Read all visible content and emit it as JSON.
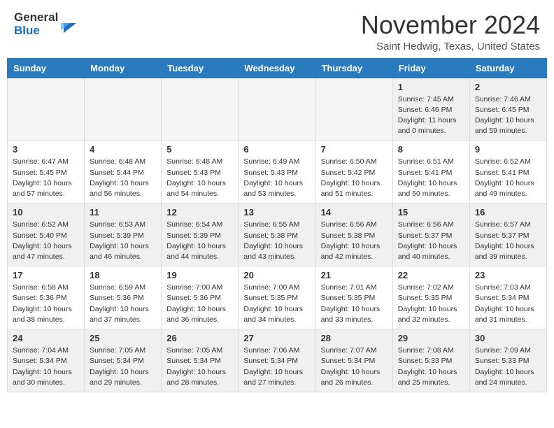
{
  "header": {
    "logo_general": "General",
    "logo_blue": "Blue",
    "month_title": "November 2024",
    "location": "Saint Hedwig, Texas, United States"
  },
  "days_of_week": [
    "Sunday",
    "Monday",
    "Tuesday",
    "Wednesday",
    "Thursday",
    "Friday",
    "Saturday"
  ],
  "weeks": [
    [
      {
        "day": "",
        "empty": true
      },
      {
        "day": "",
        "empty": true
      },
      {
        "day": "",
        "empty": true
      },
      {
        "day": "",
        "empty": true
      },
      {
        "day": "",
        "empty": true
      },
      {
        "day": "1",
        "sunrise": "Sunrise: 7:45 AM",
        "sunset": "Sunset: 6:46 PM",
        "daylight": "Daylight: 11 hours and 0 minutes."
      },
      {
        "day": "2",
        "sunrise": "Sunrise: 7:46 AM",
        "sunset": "Sunset: 6:45 PM",
        "daylight": "Daylight: 10 hours and 59 minutes."
      }
    ],
    [
      {
        "day": "3",
        "sunrise": "Sunrise: 6:47 AM",
        "sunset": "Sunset: 5:45 PM",
        "daylight": "Daylight: 10 hours and 57 minutes."
      },
      {
        "day": "4",
        "sunrise": "Sunrise: 6:48 AM",
        "sunset": "Sunset: 5:44 PM",
        "daylight": "Daylight: 10 hours and 56 minutes."
      },
      {
        "day": "5",
        "sunrise": "Sunrise: 6:48 AM",
        "sunset": "Sunset: 5:43 PM",
        "daylight": "Daylight: 10 hours and 54 minutes."
      },
      {
        "day": "6",
        "sunrise": "Sunrise: 6:49 AM",
        "sunset": "Sunset: 5:43 PM",
        "daylight": "Daylight: 10 hours and 53 minutes."
      },
      {
        "day": "7",
        "sunrise": "Sunrise: 6:50 AM",
        "sunset": "Sunset: 5:42 PM",
        "daylight": "Daylight: 10 hours and 51 minutes."
      },
      {
        "day": "8",
        "sunrise": "Sunrise: 6:51 AM",
        "sunset": "Sunset: 5:41 PM",
        "daylight": "Daylight: 10 hours and 50 minutes."
      },
      {
        "day": "9",
        "sunrise": "Sunrise: 6:52 AM",
        "sunset": "Sunset: 5:41 PM",
        "daylight": "Daylight: 10 hours and 49 minutes."
      }
    ],
    [
      {
        "day": "10",
        "sunrise": "Sunrise: 6:52 AM",
        "sunset": "Sunset: 5:40 PM",
        "daylight": "Daylight: 10 hours and 47 minutes."
      },
      {
        "day": "11",
        "sunrise": "Sunrise: 6:53 AM",
        "sunset": "Sunset: 5:39 PM",
        "daylight": "Daylight: 10 hours and 46 minutes."
      },
      {
        "day": "12",
        "sunrise": "Sunrise: 6:54 AM",
        "sunset": "Sunset: 5:39 PM",
        "daylight": "Daylight: 10 hours and 44 minutes."
      },
      {
        "day": "13",
        "sunrise": "Sunrise: 6:55 AM",
        "sunset": "Sunset: 5:38 PM",
        "daylight": "Daylight: 10 hours and 43 minutes."
      },
      {
        "day": "14",
        "sunrise": "Sunrise: 6:56 AM",
        "sunset": "Sunset: 5:38 PM",
        "daylight": "Daylight: 10 hours and 42 minutes."
      },
      {
        "day": "15",
        "sunrise": "Sunrise: 6:56 AM",
        "sunset": "Sunset: 5:37 PM",
        "daylight": "Daylight: 10 hours and 40 minutes."
      },
      {
        "day": "16",
        "sunrise": "Sunrise: 6:57 AM",
        "sunset": "Sunset: 5:37 PM",
        "daylight": "Daylight: 10 hours and 39 minutes."
      }
    ],
    [
      {
        "day": "17",
        "sunrise": "Sunrise: 6:58 AM",
        "sunset": "Sunset: 5:36 PM",
        "daylight": "Daylight: 10 hours and 38 minutes."
      },
      {
        "day": "18",
        "sunrise": "Sunrise: 6:59 AM",
        "sunset": "Sunset: 5:36 PM",
        "daylight": "Daylight: 10 hours and 37 minutes."
      },
      {
        "day": "19",
        "sunrise": "Sunrise: 7:00 AM",
        "sunset": "Sunset: 5:36 PM",
        "daylight": "Daylight: 10 hours and 36 minutes."
      },
      {
        "day": "20",
        "sunrise": "Sunrise: 7:00 AM",
        "sunset": "Sunset: 5:35 PM",
        "daylight": "Daylight: 10 hours and 34 minutes."
      },
      {
        "day": "21",
        "sunrise": "Sunrise: 7:01 AM",
        "sunset": "Sunset: 5:35 PM",
        "daylight": "Daylight: 10 hours and 33 minutes."
      },
      {
        "day": "22",
        "sunrise": "Sunrise: 7:02 AM",
        "sunset": "Sunset: 5:35 PM",
        "daylight": "Daylight: 10 hours and 32 minutes."
      },
      {
        "day": "23",
        "sunrise": "Sunrise: 7:03 AM",
        "sunset": "Sunset: 5:34 PM",
        "daylight": "Daylight: 10 hours and 31 minutes."
      }
    ],
    [
      {
        "day": "24",
        "sunrise": "Sunrise: 7:04 AM",
        "sunset": "Sunset: 5:34 PM",
        "daylight": "Daylight: 10 hours and 30 minutes."
      },
      {
        "day": "25",
        "sunrise": "Sunrise: 7:05 AM",
        "sunset": "Sunset: 5:34 PM",
        "daylight": "Daylight: 10 hours and 29 minutes."
      },
      {
        "day": "26",
        "sunrise": "Sunrise: 7:05 AM",
        "sunset": "Sunset: 5:34 PM",
        "daylight": "Daylight: 10 hours and 28 minutes."
      },
      {
        "day": "27",
        "sunrise": "Sunrise: 7:06 AM",
        "sunset": "Sunset: 5:34 PM",
        "daylight": "Daylight: 10 hours and 27 minutes."
      },
      {
        "day": "28",
        "sunrise": "Sunrise: 7:07 AM",
        "sunset": "Sunset: 5:34 PM",
        "daylight": "Daylight: 10 hours and 26 minutes."
      },
      {
        "day": "29",
        "sunrise": "Sunrise: 7:08 AM",
        "sunset": "Sunset: 5:33 PM",
        "daylight": "Daylight: 10 hours and 25 minutes."
      },
      {
        "day": "30",
        "sunrise": "Sunrise: 7:09 AM",
        "sunset": "Sunset: 5:33 PM",
        "daylight": "Daylight: 10 hours and 24 minutes."
      }
    ]
  ]
}
